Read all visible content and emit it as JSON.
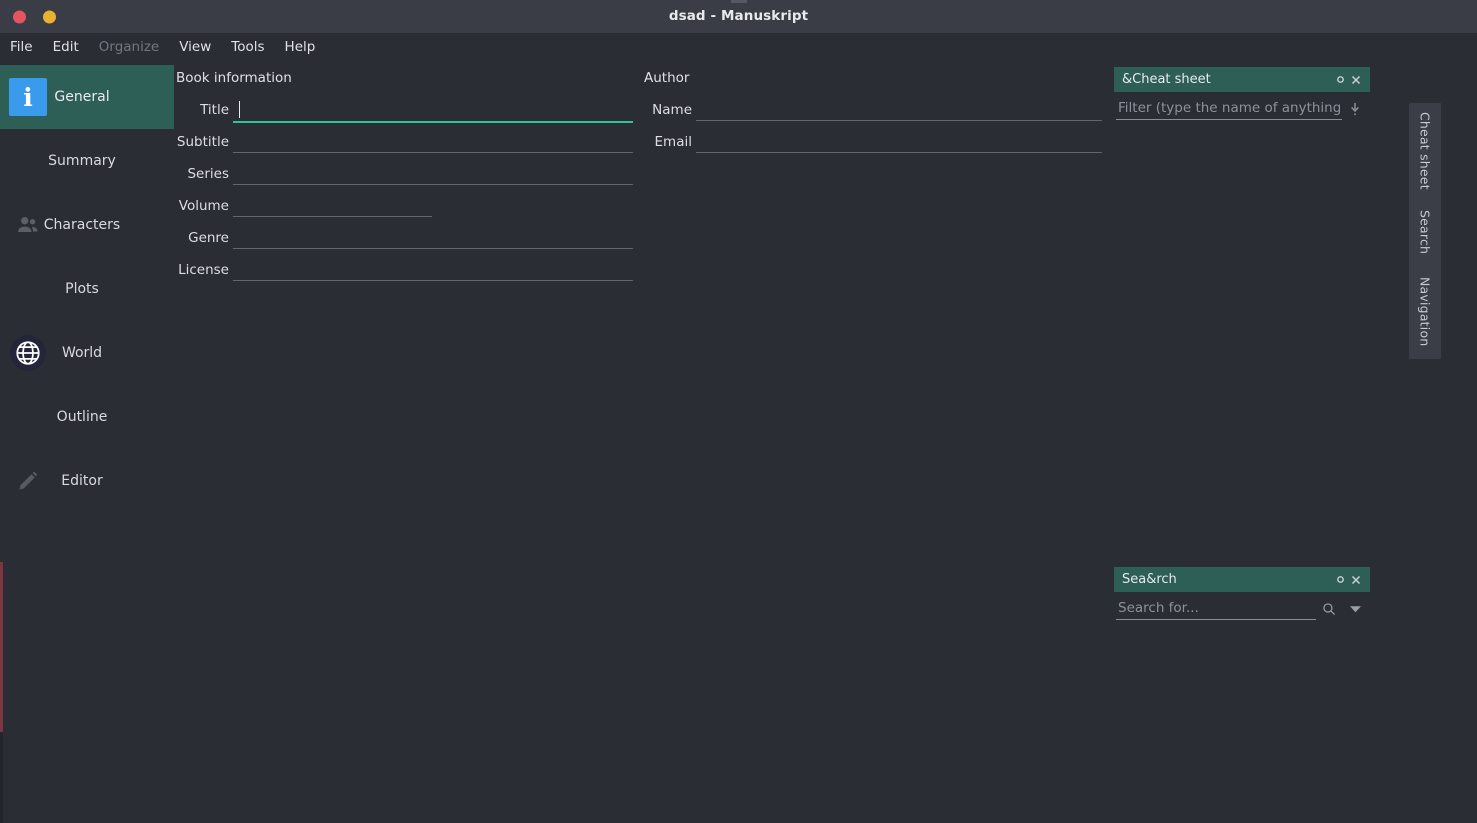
{
  "window": {
    "title": "dsad - Manuskript",
    "buttons": {
      "close": "close-button",
      "minimize": "minimize-button"
    }
  },
  "menubar": {
    "items": [
      {
        "label": "File",
        "disabled": false
      },
      {
        "label": "Edit",
        "disabled": false
      },
      {
        "label": "Organize",
        "disabled": true
      },
      {
        "label": "View",
        "disabled": false
      },
      {
        "label": "Tools",
        "disabled": false
      },
      {
        "label": "Help",
        "disabled": false
      }
    ]
  },
  "sidebar": {
    "items": [
      {
        "label": "General",
        "icon": "info-icon",
        "active": true
      },
      {
        "label": "Summary",
        "icon": "",
        "active": false
      },
      {
        "label": "Characters",
        "icon": "people-icon",
        "active": false
      },
      {
        "label": "Plots",
        "icon": "",
        "active": false
      },
      {
        "label": "World",
        "icon": "globe-icon",
        "active": false
      },
      {
        "label": "Outline",
        "icon": "",
        "active": false
      },
      {
        "label": "Editor",
        "icon": "pencil-icon",
        "active": false
      }
    ]
  },
  "book_information": {
    "group_label": "Book information",
    "fields": [
      {
        "label": "Title",
        "value": "",
        "placeholder": "",
        "focused": true
      },
      {
        "label": "Subtitle",
        "value": "",
        "placeholder": "",
        "focused": false
      },
      {
        "label": "Series",
        "value": "",
        "placeholder": "",
        "focused": false
      },
      {
        "label": "Volume",
        "value": "",
        "placeholder": "",
        "focused": false
      },
      {
        "label": "Genre",
        "value": "",
        "placeholder": "",
        "focused": false
      },
      {
        "label": "License",
        "value": "",
        "placeholder": "",
        "focused": false
      }
    ]
  },
  "author": {
    "group_label": "Author",
    "fields": [
      {
        "label": "Name",
        "value": "",
        "placeholder": ""
      },
      {
        "label": "Email",
        "value": "",
        "placeholder": ""
      }
    ]
  },
  "cheat_sheet_panel": {
    "title": "&Cheat sheet",
    "filter_value": "",
    "filter_placeholder": "Filter (type the name of anything i...",
    "float_button": "float-button",
    "close_button": "close-button",
    "down_icon": "arrow-down-icon"
  },
  "search_panel": {
    "title": "Sea&rch",
    "search_value": "",
    "search_placeholder": "Search for...",
    "float_button": "float-button",
    "close_button": "close-button",
    "search_icon": "magnifier-icon",
    "options_icon": "chevron-down-icon"
  },
  "tabstrip": {
    "tabs": [
      {
        "label": "Cheat sheet"
      },
      {
        "label": "Search"
      },
      {
        "label": "Navigation"
      }
    ]
  },
  "colors": {
    "accent_teal": "#2e5f57",
    "focus_teal": "#2fc39a",
    "info_blue": "#3a9bec",
    "close_red": "#e4555f",
    "minimize_yellow": "#e8b130",
    "background": "#2b2d34",
    "titlebar": "#3a3d45"
  }
}
